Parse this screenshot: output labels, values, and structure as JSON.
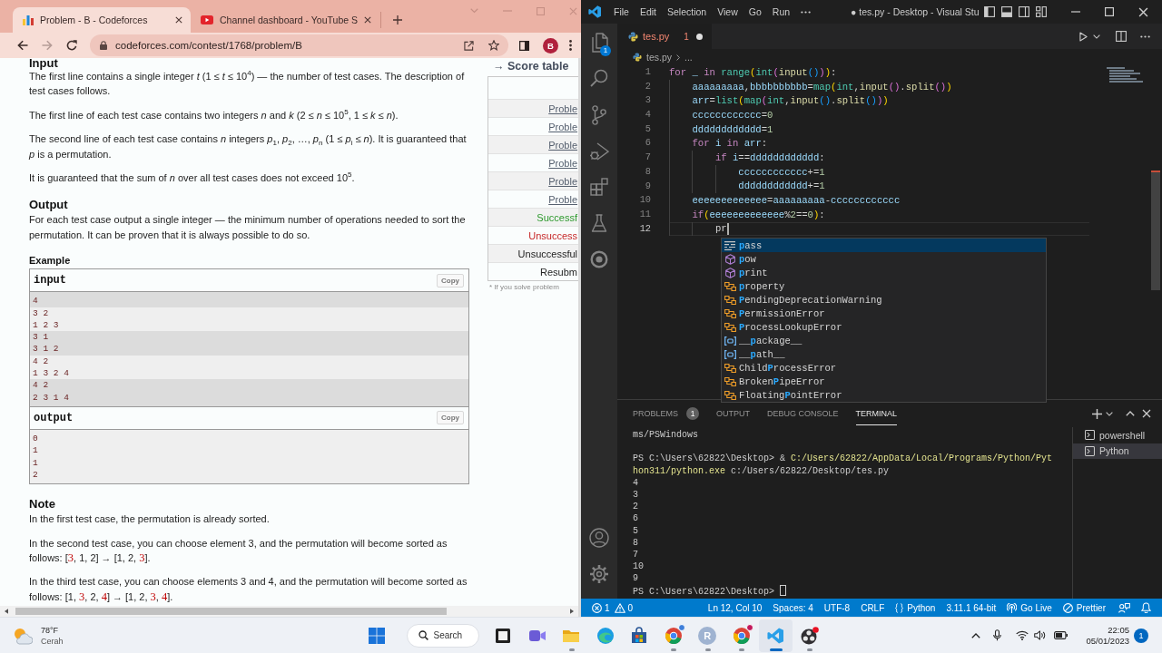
{
  "browser": {
    "tabs": [
      {
        "title": "Problem - B - Codeforces",
        "kind": "bars",
        "selected": true
      },
      {
        "title": "Channel dashboard - YouTube S",
        "kind": "play",
        "selected": false
      }
    ],
    "address": "codeforces.com/contest/1768/problem/B",
    "profile": "B",
    "statement": [
      {
        "kind": "heading",
        "text": "Input"
      },
      {
        "kind": "paragraph",
        "text": "The first line contains a single integer *t* (1 ≤ *t* ≤ 10$^{4}$) — the number of test cases. The description of test cases follows."
      },
      {
        "kind": "paragraph",
        "text": "The first line of each test case contains two integers *n* and *k* (2 ≤ *n* ≤ 10$^{5}$, 1 ≤ *k* ≤ *n*)."
      },
      {
        "kind": "paragraph",
        "text": "The second line of each test case contains *n* integers *p*$_{1}$, *p*$_{2}$, …, *p*$_{n}$ (1 ≤ *p*$_{i}$ ≤ *n*). It is guaranteed that *p* is a permutation."
      },
      {
        "kind": "paragraph",
        "text": "It is guaranteed that the sum of *n* over all test cases does not exceed 10$^{5}$."
      },
      {
        "kind": "heading",
        "text": "Output"
      },
      {
        "kind": "paragraph",
        "text": "For each test case output a single integer — the minimum number of operations needed to sort the permutation. It can be proven that it is always possible to do so."
      },
      {
        "kind": "subheading",
        "text": "Example"
      },
      {
        "kind": "sample",
        "label": "input",
        "button": "Copy",
        "groups": [
          {
            "lines": [
              "4"
            ],
            "highlighted": true
          },
          {
            "lines": [
              "3 2",
              "1 2 3"
            ],
            "highlighted": false
          },
          {
            "lines": [
              "3 1",
              "3 1 2"
            ],
            "highlighted": true
          },
          {
            "lines": [
              "4 2",
              "1 3 2 4"
            ],
            "highlighted": false
          },
          {
            "lines": [
              "4 2",
              "2 3 1 4"
            ],
            "highlighted": true
          }
        ]
      },
      {
        "kind": "sample",
        "label": "output",
        "button": "Copy",
        "groups": [
          {
            "lines": [
              "0",
              "1",
              "1",
              "2"
            ],
            "highlighted": false
          }
        ]
      },
      {
        "kind": "heading",
        "text": "Note"
      },
      {
        "kind": "paragraph",
        "text": "In the first test case, the permutation is already sorted."
      },
      {
        "kind": "paragraph",
        "parts": [
          {
            "text": "In the second test case, you can choose element 3, and the permutation will become sorted as follows: [",
            "highlighted": false
          },
          {
            "text": "3",
            "highlighted": true
          },
          {
            "text": ", 1, 2] → [1, 2, ",
            "highlighted": false
          },
          {
            "text": "3",
            "highlighted": true
          },
          {
            "text": "].",
            "highlighted": false
          }
        ]
      },
      {
        "kind": "paragraph",
        "parts": [
          {
            "text": "In the third test case, you can choose elements 3 and 4, and the permutation will become sorted as follows: [1, ",
            "highlighted": false
          },
          {
            "text": "3",
            "highlighted": true
          },
          {
            "text": ", 2, ",
            "highlighted": false
          },
          {
            "text": "4",
            "highlighted": true
          },
          {
            "text": "] → [1, 2, ",
            "highlighted": false
          },
          {
            "text": "3",
            "highlighted": true
          },
          {
            "text": ", ",
            "highlighted": false
          },
          {
            "text": "4",
            "highlighted": true
          },
          {
            "text": "].",
            "highlighted": false
          }
        ]
      }
    ],
    "sidebar": {
      "title": "→ Score table",
      "rows": [
        {
          "text": "Proble",
          "kind": "link"
        },
        {
          "text": "Proble",
          "kind": "link"
        },
        {
          "text": "Proble",
          "kind": "link"
        },
        {
          "text": "Proble",
          "kind": "link"
        },
        {
          "text": "Proble",
          "kind": "link"
        },
        {
          "text": "Proble",
          "kind": "link"
        },
        {
          "text": "Successf",
          "kind": "verdict",
          "color": "#2e9a2e"
        },
        {
          "text": "Unsuccess",
          "kind": "verdict",
          "color": "#c62828"
        },
        {
          "text": "Unsuccessful",
          "kind": "verdict",
          "color": "#222222"
        },
        {
          "text": "Resubm",
          "kind": "verdict",
          "color": "#222222"
        }
      ],
      "footnote": "* If you solve problem"
    }
  },
  "editor": {
    "menu": [
      "File",
      "Edit",
      "Selection",
      "View",
      "Go",
      "Run"
    ],
    "title": "● tes.py - Desktop - Visual Stu",
    "explorer_badge": "1",
    "tabs": [
      {
        "name": "tes.py",
        "problems": "1",
        "unsaved": true,
        "selected": true
      }
    ],
    "breadcrumb": [
      "tes.py",
      "..."
    ],
    "lines": [
      {
        "number": "1",
        "current": false,
        "tokens": [
          {
            "text": "for ",
            "kind": "keyword"
          },
          {
            "text": "_ ",
            "kind": "variable"
          },
          {
            "text": "in ",
            "kind": "keyword"
          },
          {
            "text": "range",
            "kind": "class"
          },
          {
            "text": "(",
            "kind": "bracket1"
          },
          {
            "text": "int",
            "kind": "class"
          },
          {
            "text": "(",
            "kind": "bracket2"
          },
          {
            "text": "input",
            "kind": "function"
          },
          {
            "text": "()",
            "kind": "bracket3"
          },
          {
            "text": ")",
            "kind": "bracket2"
          },
          {
            "text": ")",
            "kind": "bracket1"
          },
          {
            "text": ":",
            "kind": "plain"
          }
        ]
      },
      {
        "number": "2",
        "current": false,
        "tokens": [
          {
            "text": "    aaaaaaaaa",
            "kind": "variable"
          },
          {
            "text": ",",
            "kind": "plain"
          },
          {
            "text": "bbbbbbbbbb",
            "kind": "variable"
          },
          {
            "text": "=",
            "kind": "plain"
          },
          {
            "text": "map",
            "kind": "class"
          },
          {
            "text": "(",
            "kind": "bracket1"
          },
          {
            "text": "int",
            "kind": "class"
          },
          {
            "text": ",",
            "kind": "plain"
          },
          {
            "text": "input",
            "kind": "function"
          },
          {
            "text": "()",
            "kind": "bracket2"
          },
          {
            "text": ".",
            "kind": "plain"
          },
          {
            "text": "split",
            "kind": "function"
          },
          {
            "text": "()",
            "kind": "bracket2"
          },
          {
            "text": ")",
            "kind": "bracket1"
          }
        ]
      },
      {
        "number": "3",
        "current": false,
        "tokens": [
          {
            "text": "    arr",
            "kind": "variable"
          },
          {
            "text": "=",
            "kind": "plain"
          },
          {
            "text": "list",
            "kind": "class"
          },
          {
            "text": "(",
            "kind": "bracket1"
          },
          {
            "text": "map",
            "kind": "class"
          },
          {
            "text": "(",
            "kind": "bracket2"
          },
          {
            "text": "int",
            "kind": "class"
          },
          {
            "text": ",",
            "kind": "plain"
          },
          {
            "text": "input",
            "kind": "function"
          },
          {
            "text": "()",
            "kind": "bracket3"
          },
          {
            "text": ".",
            "kind": "plain"
          },
          {
            "text": "split",
            "kind": "function"
          },
          {
            "text": "()",
            "kind": "bracket3"
          },
          {
            "text": ")",
            "kind": "bracket2"
          },
          {
            "text": ")",
            "kind": "bracket1"
          }
        ]
      },
      {
        "number": "4",
        "current": false,
        "tokens": [
          {
            "text": "    cccccccccccc",
            "kind": "variable"
          },
          {
            "text": "=",
            "kind": "plain"
          },
          {
            "text": "0",
            "kind": "number"
          }
        ]
      },
      {
        "number": "5",
        "current": false,
        "tokens": [
          {
            "text": "    dddddddddddd",
            "kind": "variable"
          },
          {
            "text": "=",
            "kind": "plain"
          },
          {
            "text": "1",
            "kind": "number"
          }
        ]
      },
      {
        "number": "6",
        "current": false,
        "tokens": [
          {
            "text": "    for ",
            "kind": "keyword"
          },
          {
            "text": "i ",
            "kind": "variable"
          },
          {
            "text": "in ",
            "kind": "keyword"
          },
          {
            "text": "arr",
            "kind": "variable"
          },
          {
            "text": ":",
            "kind": "plain"
          }
        ]
      },
      {
        "number": "7",
        "current": false,
        "tokens": [
          {
            "text": "        if ",
            "kind": "keyword"
          },
          {
            "text": "i",
            "kind": "variable"
          },
          {
            "text": "==",
            "kind": "plain"
          },
          {
            "text": "dddddddddddd",
            "kind": "variable"
          },
          {
            "text": ":",
            "kind": "plain"
          }
        ]
      },
      {
        "number": "8",
        "current": false,
        "tokens": [
          {
            "text": "            cccccccccccc",
            "kind": "variable"
          },
          {
            "text": "+=",
            "kind": "plain"
          },
          {
            "text": "1",
            "kind": "number"
          }
        ]
      },
      {
        "number": "9",
        "current": false,
        "tokens": [
          {
            "text": "            dddddddddddd",
            "kind": "variable"
          },
          {
            "text": "+=",
            "kind": "plain"
          },
          {
            "text": "1",
            "kind": "number"
          }
        ]
      },
      {
        "number": "10",
        "current": false,
        "tokens": [
          {
            "text": "    eeeeeeeeeeeee",
            "kind": "variable"
          },
          {
            "text": "=",
            "kind": "plain"
          },
          {
            "text": "aaaaaaaaa",
            "kind": "variable"
          },
          {
            "text": "-",
            "kind": "plain"
          },
          {
            "text": "cccccccccccc",
            "kind": "variable"
          }
        ]
      },
      {
        "number": "11",
        "current": false,
        "tokens": [
          {
            "text": "    if",
            "kind": "keyword"
          },
          {
            "text": "(",
            "kind": "bracket1"
          },
          {
            "text": "eeeeeeeeeeeee",
            "kind": "variable"
          },
          {
            "text": "%",
            "kind": "plain"
          },
          {
            "text": "2",
            "kind": "number"
          },
          {
            "text": "==",
            "kind": "plain"
          },
          {
            "text": "0",
            "kind": "number"
          },
          {
            "text": ")",
            "kind": "bracket1"
          },
          {
            "text": ":",
            "kind": "plain"
          }
        ]
      },
      {
        "number": "12",
        "current": true,
        "tokens": [
          {
            "text": "        pr",
            "kind": "plain"
          }
        ]
      }
    ],
    "suggestions": [
      {
        "kind": "keyword",
        "match": "p",
        "after": "ass",
        "selected": true
      },
      {
        "kind": "function",
        "match": "p",
        "after": "ow",
        "selected": false
      },
      {
        "kind": "function",
        "match": "p",
        "after": "rint",
        "selected": false
      },
      {
        "kind": "class",
        "match": "p",
        "after": "roperty",
        "selected": false
      },
      {
        "kind": "class",
        "match": "P",
        "after": "endingDeprecationWarning",
        "selected": false
      },
      {
        "kind": "class",
        "match": "P",
        "after": "ermissionError",
        "selected": false
      },
      {
        "kind": "class",
        "match": "P",
        "after": "rocessLookupError",
        "selected": false
      },
      {
        "kind": "variable",
        "before": "__",
        "match": "p",
        "after": "ackage__",
        "selected": false
      },
      {
        "kind": "variable",
        "before": "__",
        "match": "p",
        "after": "ath__",
        "selected": false
      },
      {
        "kind": "class",
        "before": "Child",
        "match": "P",
        "after": "rocessError",
        "selected": false
      },
      {
        "kind": "class",
        "before": "Broken",
        "match": "P",
        "after": "ipeError",
        "selected": false
      },
      {
        "kind": "class",
        "before": "Floating",
        "match": "P",
        "after": "ointError",
        "selected": false
      }
    ],
    "panel": {
      "tabs": [
        {
          "label": "PROBLEMS",
          "badge": "1",
          "selected": false
        },
        {
          "label": "OUTPUT",
          "selected": false
        },
        {
          "label": "DEBUG CONSOLE",
          "selected": false
        },
        {
          "label": "TERMINAL",
          "selected": true
        }
      ],
      "terminal_lines": [
        {
          "kind": "output",
          "text": "ms/PSWindows"
        },
        {
          "kind": "blank"
        },
        {
          "kind": "command",
          "prompt": "PS C:\\Users\\62822\\Desktop>",
          "operator": "&",
          "program": "C:/Users/62822/AppData/Local/Programs/Python/Python311/python.exe",
          "argument": "c:/Users/62822/Desktop/tes.py"
        },
        {
          "kind": "output",
          "text": "4"
        },
        {
          "kind": "output",
          "text": "3"
        },
        {
          "kind": "output",
          "text": "2"
        },
        {
          "kind": "output",
          "text": "6"
        },
        {
          "kind": "output",
          "text": "5"
        },
        {
          "kind": "output",
          "text": "8"
        },
        {
          "kind": "output",
          "text": "7"
        },
        {
          "kind": "output",
          "text": "10"
        },
        {
          "kind": "output",
          "text": "9"
        },
        {
          "kind": "prompt",
          "prompt": "PS C:\\Users\\62822\\Desktop>"
        }
      ],
      "terminals": [
        {
          "name": "powershell",
          "selected": false
        },
        {
          "name": "Python",
          "selected": true
        }
      ]
    },
    "status": {
      "errors": "1",
      "warnings": "0",
      "items": [
        {
          "text": "Ln 12, Col 10",
          "kind": "text"
        },
        {
          "text": "Spaces: 4",
          "kind": "text"
        },
        {
          "text": "UTF-8",
          "kind": "text"
        },
        {
          "text": "CRLF",
          "kind": "text"
        },
        {
          "text": "Python",
          "kind": "language"
        },
        {
          "text": "3.11.1 64-bit",
          "kind": "text"
        },
        {
          "text": "Go Live",
          "kind": "live"
        },
        {
          "text": "Prettier",
          "kind": "formatter"
        }
      ]
    }
  },
  "taskbar": {
    "weather": {
      "temperature": "78°F",
      "condition": "Cerah"
    },
    "search": "Search",
    "apps": [
      {
        "kind": "start",
        "running": false,
        "selected": false
      },
      {
        "kind": "taskview",
        "running": false,
        "selected": false
      },
      {
        "kind": "chat",
        "running": false,
        "selected": false
      },
      {
        "kind": "explorer",
        "running": true,
        "selected": false
      },
      {
        "kind": "edge",
        "running": false,
        "selected": false
      },
      {
        "kind": "store",
        "running": false,
        "selected": false
      },
      {
        "kind": "chrome",
        "color": "#3f7fd9",
        "running": true,
        "selected": false
      },
      {
        "kind": "letter",
        "letter": "R",
        "running": true,
        "selected": false
      },
      {
        "kind": "chrome",
        "color": "#c2185b",
        "running": true,
        "selected": false
      },
      {
        "kind": "vscode",
        "running": true,
        "selected": true
      },
      {
        "kind": "obs",
        "running": true,
        "selected": false
      }
    ],
    "time": "22:05",
    "date": "05/01/2023",
    "notifications": "1"
  }
}
